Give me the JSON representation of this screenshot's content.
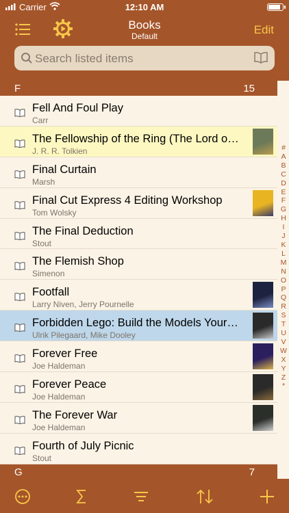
{
  "status": {
    "carrier": "Carrier",
    "time": "12:10 AM",
    "battery_level": 0.9
  },
  "nav": {
    "title": "Books",
    "subtitle": "Default",
    "edit_label": "Edit",
    "list_icon": "list-icon",
    "gear_icon": "gear-play-icon"
  },
  "search": {
    "placeholder": "Search listed items"
  },
  "sections": [
    {
      "letter": "F",
      "count": "15"
    },
    {
      "letter": "G",
      "count": "7"
    }
  ],
  "rows": [
    {
      "title": "Fell And Foul Play",
      "author": "Carr",
      "thumb": false
    },
    {
      "title": "The Fellowship of the Ring (The Lord of the Rings)",
      "author": "J. R. R. Tolkien",
      "thumb": true,
      "highlight": "yellow",
      "thumb_colors": [
        "#6d7a5a",
        "#b89c4c"
      ]
    },
    {
      "title": "Final Curtain",
      "author": "Marsh",
      "thumb": false
    },
    {
      "title": "Final Cut Express 4 Editing Workshop",
      "author": "Tom Wolsky",
      "thumb": true,
      "thumb_colors": [
        "#e9b422",
        "#3a3a6a"
      ]
    },
    {
      "title": "The Final Deduction",
      "author": "Stout",
      "thumb": false
    },
    {
      "title": "The Flemish Shop",
      "author": "Simenon",
      "thumb": false
    },
    {
      "title": "Footfall",
      "author": "Larry Niven, Jerry Pournelle",
      "thumb": true,
      "thumb_colors": [
        "#1d2240",
        "#7b8cc2"
      ]
    },
    {
      "title": "Forbidden Lego: Build the Models Your Parents Warned You Against",
      "author": "Ulrik Pilegaard, Mike Dooley",
      "thumb": true,
      "highlight": "blue",
      "thumb_colors": [
        "#2a2a2a",
        "#c7c7c7"
      ]
    },
    {
      "title": "Forever Free",
      "author": "Joe Haldeman",
      "thumb": true,
      "thumb_colors": [
        "#2c1f5e",
        "#d9b34a"
      ]
    },
    {
      "title": "Forever Peace",
      "author": "Joe Haldeman",
      "thumb": true,
      "thumb_colors": [
        "#2a2a2a",
        "#8a6a3a"
      ]
    },
    {
      "title": "The Forever War",
      "author": "Joe Haldeman",
      "thumb": true,
      "thumb_colors": [
        "#2b2f2a",
        "#cfcfcf"
      ]
    },
    {
      "title": "Fourth of July Picnic",
      "author": "Stout",
      "thumb": false
    }
  ],
  "index_letters": [
    "#",
    "A",
    "B",
    "C",
    "D",
    "E",
    "F",
    "G",
    "H",
    "I",
    "J",
    "K",
    "L",
    "M",
    "N",
    "O",
    "P",
    "Q",
    "R",
    "S",
    "T",
    "U",
    "V",
    "W",
    "X",
    "Y",
    "Z",
    "*"
  ],
  "toolbar": {
    "more_icon": "more-circle-icon",
    "sum_icon": "sum-icon",
    "filter_icon": "filter-lines-icon",
    "sort_icon": "sort-arrows-icon",
    "add_icon": "plus-icon"
  },
  "colors": {
    "accent": "#a5552a",
    "gold": "#f8c84a",
    "background": "#fbf3e6"
  }
}
